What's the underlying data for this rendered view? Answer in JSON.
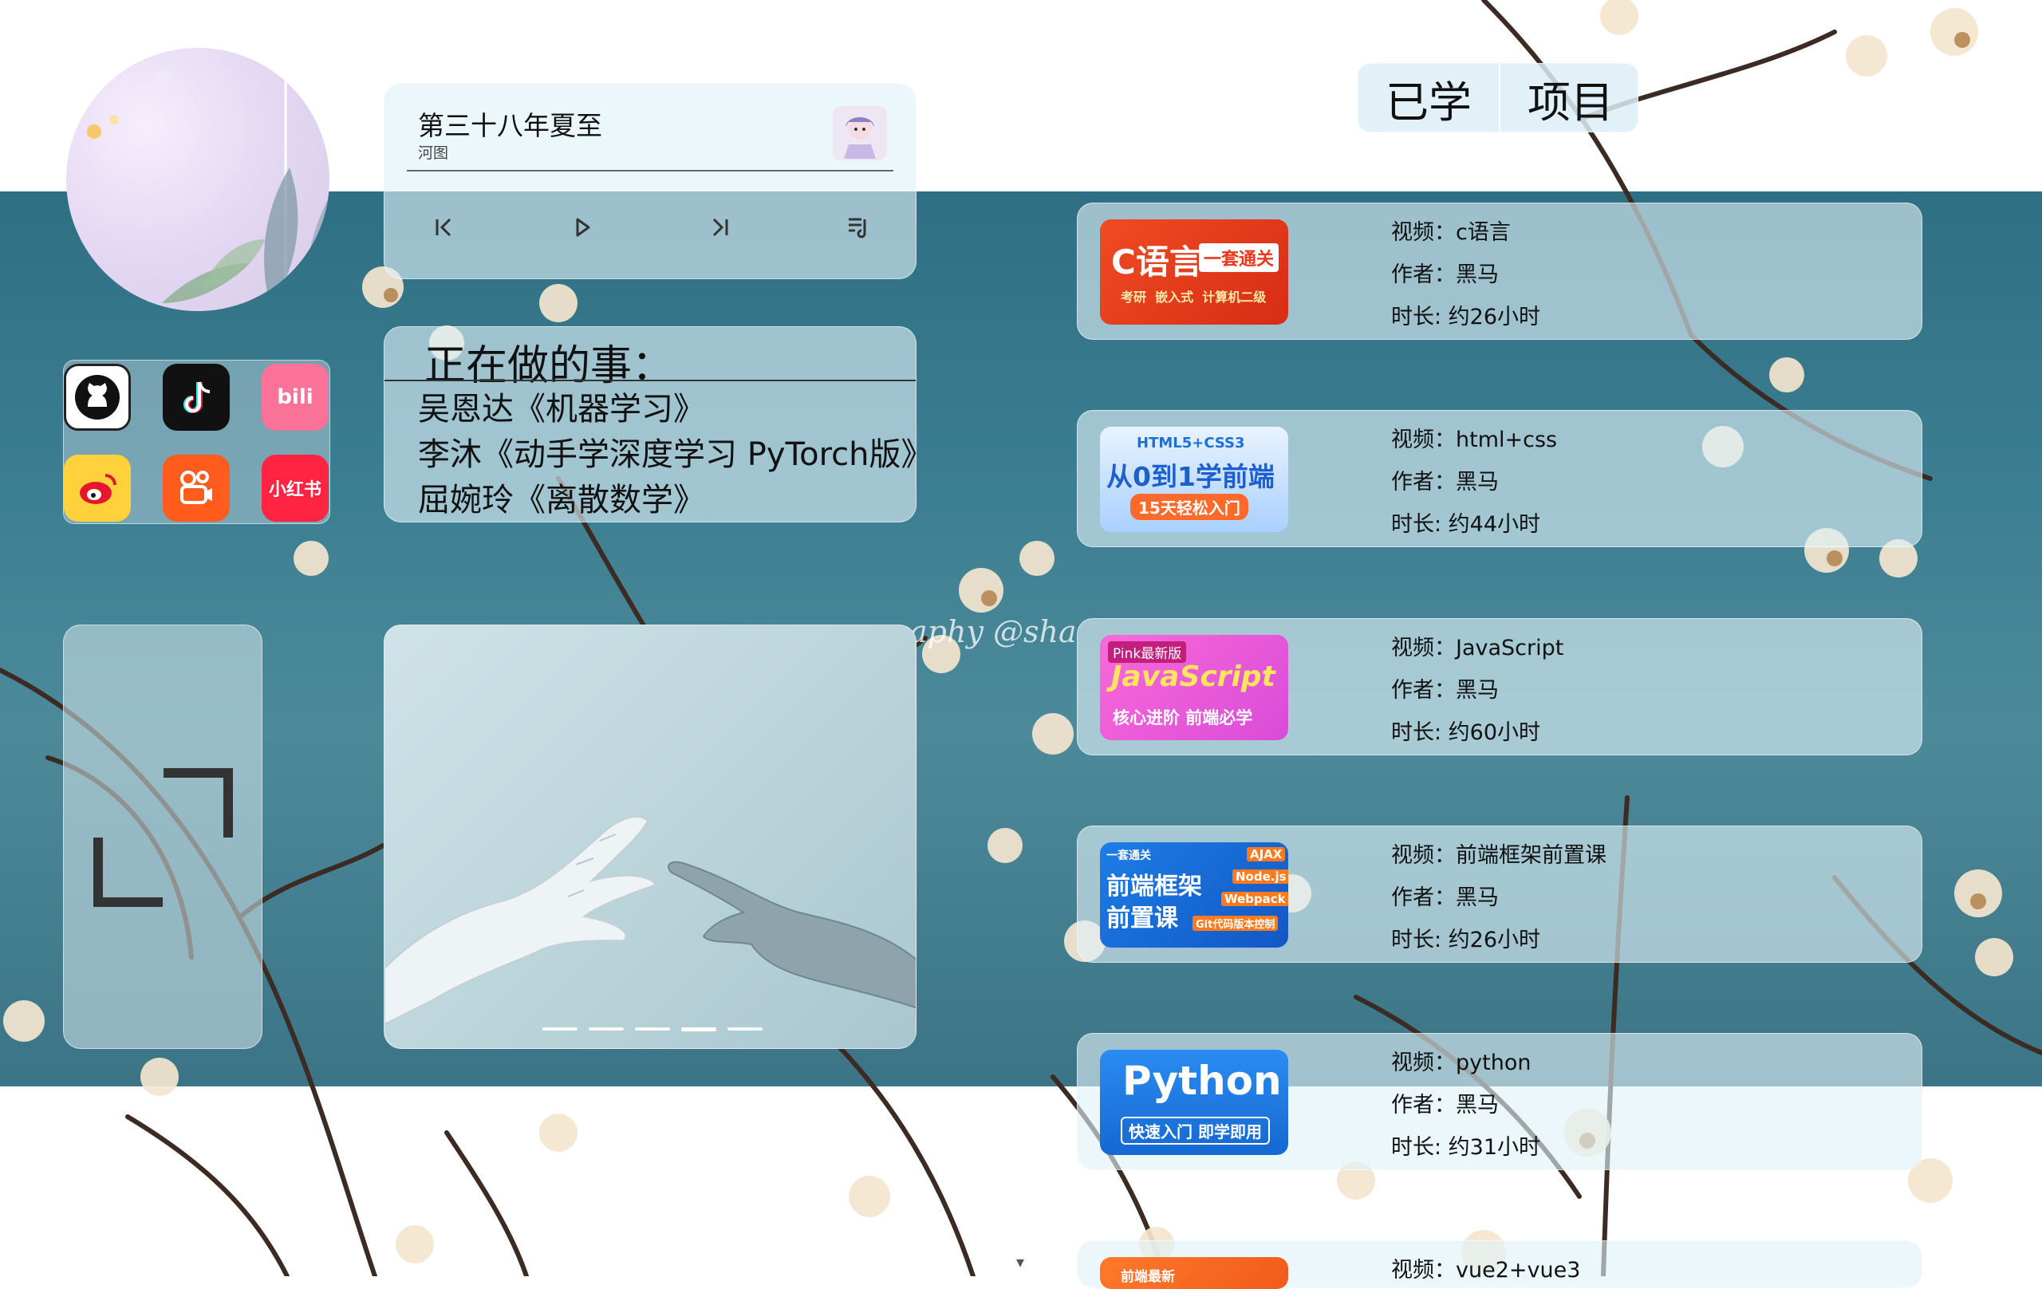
{
  "music": {
    "title": "第三十八年夏至",
    "artist": "河图"
  },
  "todo": {
    "heading": "正在做的事：",
    "items": [
      "吴恩达《机器学习》",
      "李沐《动手学深度学习 PyTorch版》",
      "屈婉玲《离散数学》"
    ]
  },
  "social": [
    {
      "name": "github-icon"
    },
    {
      "name": "tiktok-icon"
    },
    {
      "name": "bilibili-icon"
    },
    {
      "name": "weibo-icon"
    },
    {
      "name": "kuaishou-icon"
    },
    {
      "name": "xiaohongshu-icon"
    }
  ],
  "tabs": [
    "已学",
    "项目"
  ],
  "watermark": "aphy @sha",
  "carousel": {
    "slide_count": 5,
    "active_index": 3
  },
  "courses": [
    {
      "video": "视频：c语言",
      "author": "作者：黑马",
      "duration": "时长: 约26小时",
      "thumb": {
        "main": "C语言",
        "tag": "一套通关",
        "sub": "考研  嵌入式  计算机二级"
      }
    },
    {
      "video": "视频：html+css",
      "author": "作者：黑马",
      "duration": "时长: 约44小时",
      "thumb": {
        "top": "HTML5+CSS3",
        "main": "从0到1学前端",
        "sub": "15天轻松入门"
      }
    },
    {
      "video": "视频：JavaScript",
      "author": "作者：黑马",
      "duration": "时长: 约60小时",
      "thumb": {
        "tag": "Pink最新版",
        "main": "JavaScript",
        "sub": "核心进阶 前端必学"
      }
    },
    {
      "video": "视频：前端框架前置课",
      "author": "作者：黑马",
      "duration": "时长: 约26小时",
      "thumb": {
        "tag": "一套通关",
        "main": "前端框架",
        "main2": "前置课",
        "chips": [
          "AJAX",
          "Node.js",
          "Webpack",
          "Git代码版本控制"
        ]
      }
    },
    {
      "video": "视频：python",
      "author": "作者：黑马",
      "duration": "时长: 约31小时",
      "thumb": {
        "main": "Python",
        "sub": "快速入门 即学即用"
      }
    },
    {
      "video": "视频：vue2+vue3",
      "author": "",
      "duration": "",
      "thumb": {
        "tag": "前端最新"
      }
    }
  ],
  "colors": {
    "accent_blue": "#1e6fd9",
    "c_red": "#e8391f",
    "js_pink": "#e94fc5",
    "python_blue": "#1f7de0"
  }
}
